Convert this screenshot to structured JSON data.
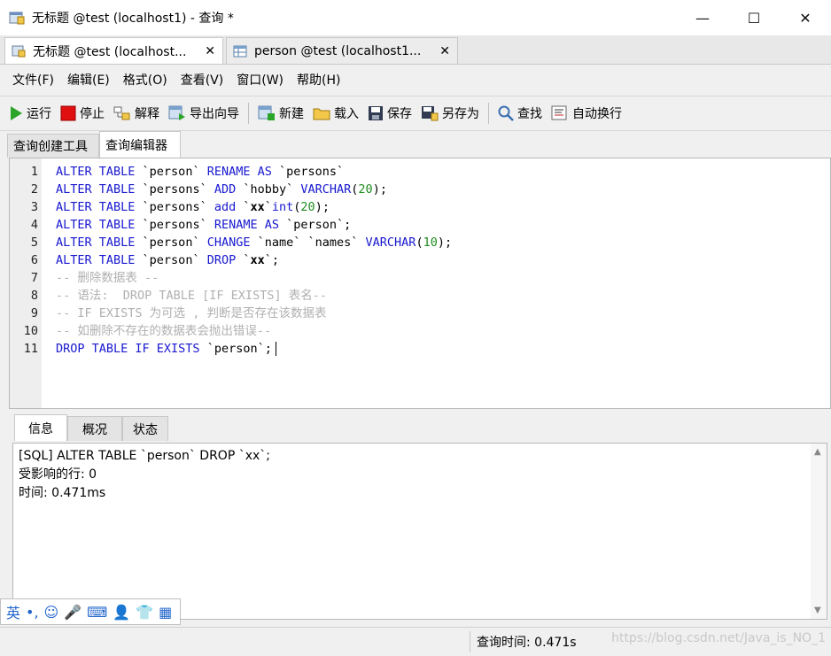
{
  "window": {
    "title": "无标题 @test (localhost1) - 查询 *",
    "controls": {
      "minimize": "—",
      "maximize": "☐",
      "close": "✕"
    }
  },
  "doc_tabs": [
    {
      "label": "无标题 @test (localhost...",
      "close": "✕"
    },
    {
      "label": "person @test (localhost1...",
      "close": "✕"
    }
  ],
  "menu": [
    "文件(F)",
    "编辑(E)",
    "格式(O)",
    "查看(V)",
    "窗口(W)",
    "帮助(H)"
  ],
  "toolbar": {
    "run": "运行",
    "stop": "停止",
    "explain": "解释",
    "export_wizard": "导出向导",
    "new": "新建",
    "load": "载入",
    "save": "保存",
    "save_as": "另存为",
    "find": "查找",
    "word_wrap": "自动换行"
  },
  "sub_tabs": {
    "builder": "查询创建工具",
    "editor": "查询编辑器"
  },
  "editor": {
    "lines": [
      {
        "n": "1",
        "parts": [
          [
            "kw",
            "ALTER TABLE "
          ],
          [
            "id",
            "`person` "
          ],
          [
            "kw",
            "RENAME AS "
          ],
          [
            "id",
            "`persons`"
          ]
        ]
      },
      {
        "n": "2",
        "parts": [
          [
            "kw",
            "ALTER TABLE "
          ],
          [
            "id",
            "`persons` "
          ],
          [
            "kw",
            "ADD "
          ],
          [
            "id",
            "`hobby` "
          ],
          [
            "kw",
            "VARCHAR"
          ],
          [
            "id",
            "("
          ],
          [
            "num",
            "20"
          ],
          [
            "id",
            ");"
          ]
        ]
      },
      {
        "n": "3",
        "parts": [
          [
            "kw",
            "ALTER TABLE "
          ],
          [
            "id",
            "`persons` "
          ],
          [
            "kw",
            "add "
          ],
          [
            "id",
            "`"
          ],
          [
            "idb",
            "xx"
          ],
          [
            "id",
            "`"
          ],
          [
            "kw",
            "int"
          ],
          [
            "id",
            "("
          ],
          [
            "num",
            "20"
          ],
          [
            "id",
            ");"
          ]
        ]
      },
      {
        "n": "4",
        "parts": [
          [
            "kw",
            "ALTER TABLE "
          ],
          [
            "id",
            "`persons` "
          ],
          [
            "kw",
            "RENAME AS "
          ],
          [
            "id",
            "`person`;"
          ]
        ]
      },
      {
        "n": "5",
        "parts": [
          [
            "kw",
            "ALTER TABLE "
          ],
          [
            "id",
            "`person` "
          ],
          [
            "kw",
            "CHANGE "
          ],
          [
            "id",
            "`name` `names` "
          ],
          [
            "kw",
            "VARCHAR"
          ],
          [
            "id",
            "("
          ],
          [
            "num",
            "10"
          ],
          [
            "id",
            ");"
          ]
        ]
      },
      {
        "n": "6",
        "parts": [
          [
            "kw",
            "ALTER TABLE "
          ],
          [
            "id",
            "`person` "
          ],
          [
            "kw",
            "DROP "
          ],
          [
            "id",
            "`"
          ],
          [
            "idb",
            "xx"
          ],
          [
            "id",
            "`;"
          ]
        ]
      },
      {
        "n": "7",
        "parts": [
          [
            "cm",
            "-- 删除数据表 --"
          ]
        ]
      },
      {
        "n": "8",
        "parts": [
          [
            "cm",
            "-- 语法:  DROP TABLE [IF EXISTS] 表名--"
          ]
        ]
      },
      {
        "n": "9",
        "parts": [
          [
            "cm",
            "-- IF EXISTS 为可选 , 判断是否存在该数据表"
          ]
        ]
      },
      {
        "n": "10",
        "parts": [
          [
            "cm",
            "-- 如删除不存在的数据表会抛出错误--"
          ]
        ]
      },
      {
        "n": "11",
        "parts": [
          [
            "kw",
            "DROP TABLE IF EXISTS "
          ],
          [
            "id",
            "`person`;"
          ]
        ]
      }
    ]
  },
  "info_tabs": {
    "info": "信息",
    "overview": "概况",
    "status": "状态"
  },
  "info": {
    "sql": "[SQL] ALTER TABLE `person` DROP `xx`;",
    "affected": "受影响的行: 0",
    "time": "时间: 0.471ms"
  },
  "ime": {
    "lang": "英",
    "punct": "•,",
    "emoji": "☺",
    "mic": "🎤",
    "keyboard": "⌨",
    "user": "👤",
    "skin": "👕",
    "grid": "▦"
  },
  "status": {
    "query_time": "查询时间: 0.471s",
    "watermark": "https://blog.csdn.net/Java_is_NO_1"
  },
  "colors": {
    "keyword": "#1818d0",
    "number": "#1e8c1e",
    "comment": "#b0b0b0"
  }
}
